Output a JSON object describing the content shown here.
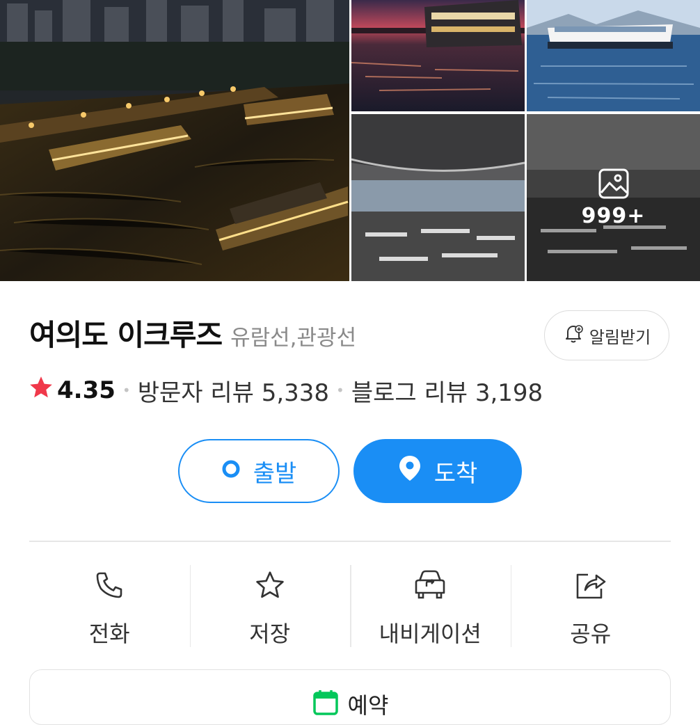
{
  "gallery": {
    "more_count": "999+",
    "photos": [
      {
        "name": "night-cruise-aerial"
      },
      {
        "name": "sunset-cruise"
      },
      {
        "name": "daytime-cruise"
      },
      {
        "name": "dining-hall"
      },
      {
        "name": "banquet-hall"
      }
    ]
  },
  "place": {
    "name": "여의도 이크루즈",
    "category": "유람선,관광선"
  },
  "alarm": {
    "label": "알림받기"
  },
  "rating": {
    "score": "4.35",
    "visitor_reviews": "방문자 리뷰 5,338",
    "blog_reviews": "블로그 리뷰 3,198",
    "star_color": "#f0384a"
  },
  "route": {
    "depart_label": "출발",
    "arrive_label": "도착",
    "accent_color": "#1a8ef5"
  },
  "actions": [
    {
      "label": "전화",
      "icon": "phone-icon"
    },
    {
      "label": "저장",
      "icon": "star-outline-icon"
    },
    {
      "label": "내비게이션",
      "icon": "car-navigation-icon"
    },
    {
      "label": "공유",
      "icon": "share-icon"
    }
  ],
  "reserve": {
    "label": "예약",
    "icon": "calendar-icon",
    "icon_color": "#03c75a"
  }
}
